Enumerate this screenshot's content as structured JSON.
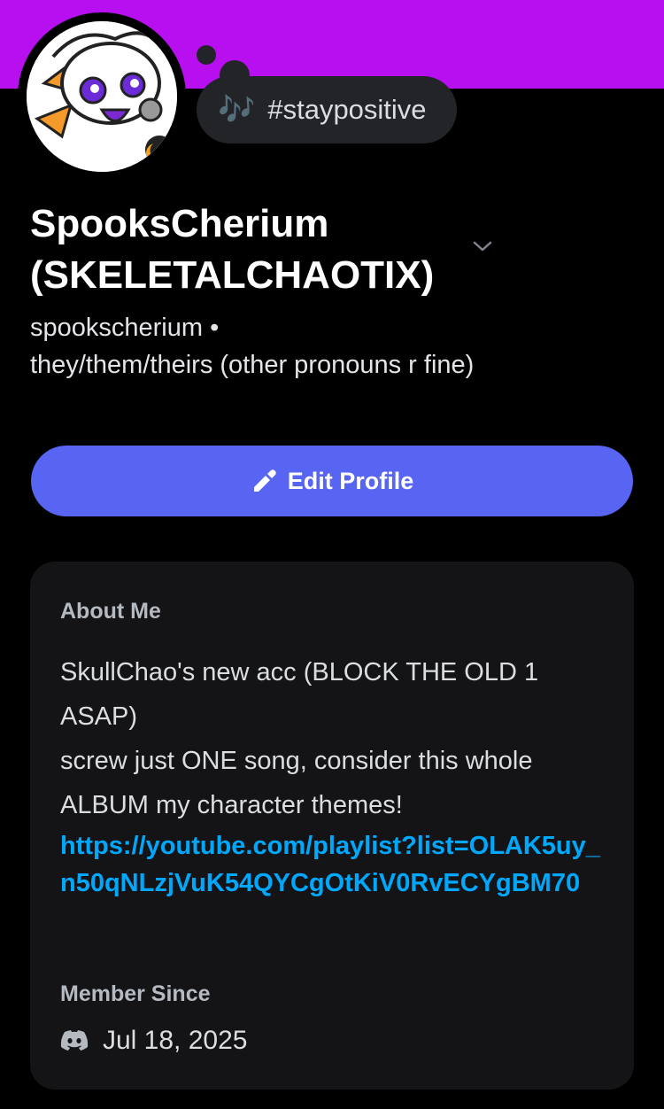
{
  "status": {
    "emoji": "🎶",
    "text": "#staypositive"
  },
  "profile": {
    "display_name_line1": "SpooksCherium",
    "display_name_line2": "(SKELETALCHAOTIX)",
    "username": "spookscherium •",
    "pronouns": "they/them/theirs (other pronouns r fine)"
  },
  "actions": {
    "edit_profile_label": "Edit Profile"
  },
  "about": {
    "title": "About Me",
    "lines": [
      "SkullChao's new acc (BLOCK THE OLD 1",
      "ASAP)",
      "screw just ONE song, consider this whole",
      "ALBUM my character themes!"
    ],
    "link": "https://youtube.com/playlist?list=OLAK5uy_n50qNLzjVuK54QYCgOtKiV0RvECYgBM70"
  },
  "member_since": {
    "title": "Member Since",
    "date": "Jul 18, 2025"
  },
  "colors": {
    "banner": "#b80ff0",
    "accent_button": "#5865f2",
    "link": "#00a8fc"
  }
}
